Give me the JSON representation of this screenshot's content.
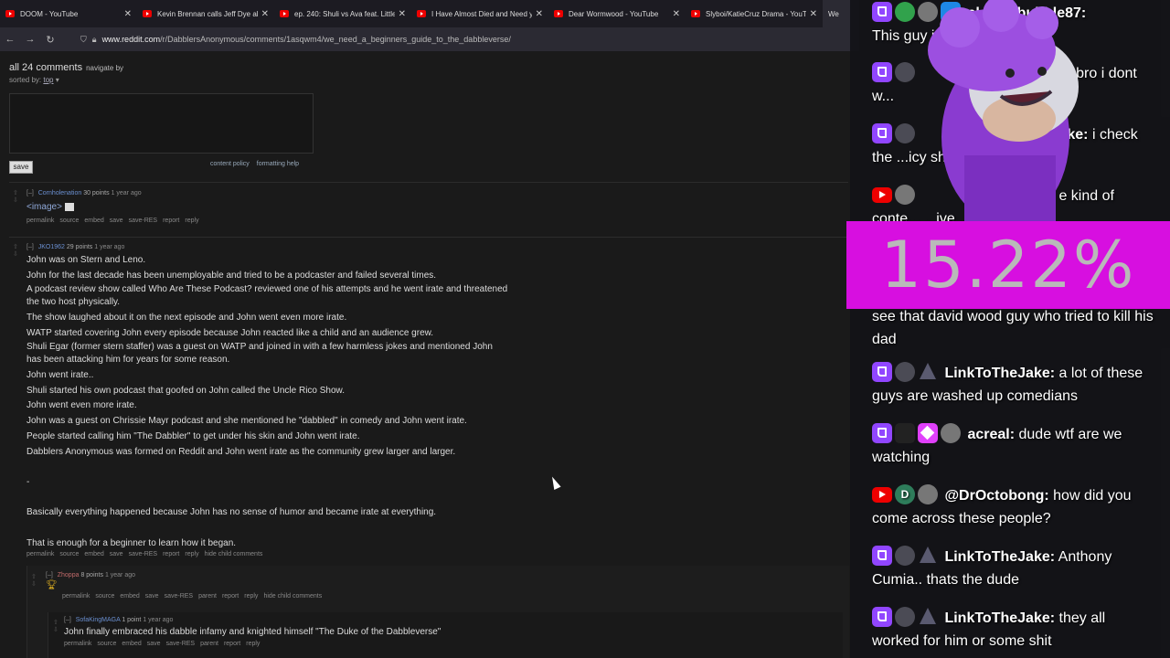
{
  "browser": {
    "tabs": [
      {
        "title": "DOOM - YouTube"
      },
      {
        "title": "Kevin Brennan calls Jeff Dye ab"
      },
      {
        "title": "ep. 240: Shuli vs Ava feat. Little"
      },
      {
        "title": "I Have Almost Died and Need y"
      },
      {
        "title": "Dear Wormwood - YouTube"
      },
      {
        "title": "Slyboi/KatieCruz Drama - YouTu"
      },
      {
        "title": "We"
      }
    ],
    "url_host": "www.reddit.com",
    "url_path": "/r/DabblersAnonymous/comments/1asqwm4/we_need_a_beginners_guide_to_the_dabbleverse/"
  },
  "reddit": {
    "comments_header": "all 24 comments",
    "navigate": "navigate by",
    "sorted_label": "sorted by:",
    "sorted_value": "top",
    "save_label": "save",
    "content_policy": "content policy",
    "formatting_help": "formatting help",
    "comments": [
      {
        "toggle": "[–]",
        "author": "Cornholenation",
        "points": "30 points",
        "age": "1 year ago",
        "body": [
          "<image>"
        ],
        "links": [
          "permalink",
          "source",
          "embed",
          "save",
          "save-RES",
          "report",
          "reply"
        ]
      },
      {
        "toggle": "[–]",
        "author": "JKO1962",
        "points": "29 points",
        "age": "1 year ago",
        "body": [
          "John was on Stern and Leno.",
          "John for the last decade has been unemployable and tried to be a podcaster and failed several times.",
          "A podcast review show called Who Are These Podcast? reviewed one of his attempts and he went irate and threatened",
          "the two host physically.",
          "The show laughed about it on the next episode and John went even more irate.",
          "WATP started covering John every episode because John reacted like a child and an audience grew.",
          "Shuli Egar (former stern staffer) was a guest on WATP and joined in with a few harmless jokes and mentioned John",
          "has been attacking him for years for some reason.",
          "John went irate..",
          "Shuli started his own podcast that goofed on John called the Uncle Rico Show.",
          "John went even more irate.",
          "John was a guest on Chrissie Mayr podcast and she mentioned he \"dabbled\" in comedy and John went irate.",
          "People started calling him \"The Dabbler\" to get under his skin and John went irate.",
          "Dabblers Anonymous was formed on Reddit and John went irate as the community grew larger and larger.",
          "",
          "-",
          "",
          "Basically everything happened because John has no sense of humor and became irate at everything.",
          "",
          "That is enough for a beginner to learn how it began."
        ],
        "links": [
          "permalink",
          "source",
          "embed",
          "save",
          "save-RES",
          "report",
          "reply",
          "hide child comments"
        ]
      },
      {
        "toggle": "[–]",
        "author": "Zhoppa",
        "points": "8 points",
        "age": "1 year ago",
        "links": [
          "permalink",
          "source",
          "embed",
          "save",
          "save-RES",
          "parent",
          "report",
          "reply",
          "hide child comments"
        ]
      },
      {
        "toggle": "[–]",
        "author": "SofaKingMAGA",
        "points": "1 point",
        "age": "1 year ago",
        "body": [
          "John finally embraced his dabble infamy and knighted himself \"The Duke of the Dabbleverse\""
        ],
        "links": [
          "permalink",
          "source",
          "embed",
          "save",
          "save-RES",
          "parent",
          "report",
          "reply"
        ]
      }
    ]
  },
  "overlay": {
    "percent": "15.22%",
    "accent": "#d70fe0",
    "messages": [
      {
        "name": "elontrobubble87:",
        "text": "This guy is t... nuts"
      },
      {
        "name": "e:",
        "text": "bro i dont w..."
      },
      {
        "name": "ake:",
        "text": "i check the ...icy shit"
      },
      {
        "name": "",
        "text": "e kind of conte... ...ive"
      },
      {
        "name": "",
        "text": "see that david wood guy who tried to kill his dad"
      },
      {
        "name": "LinkToTheJake:",
        "text": "a lot of these guys are washed up comedians"
      },
      {
        "name": "acreal:",
        "text": "dude wtf are we watching"
      },
      {
        "name": "@DrOctobong:",
        "text": "how did you come across these people?"
      },
      {
        "name": "LinkToTheJake:",
        "text": "Anthony Cumia.. thats the dude"
      },
      {
        "name": "LinkToTheJake:",
        "text": "they all worked for him or some shit"
      }
    ]
  }
}
